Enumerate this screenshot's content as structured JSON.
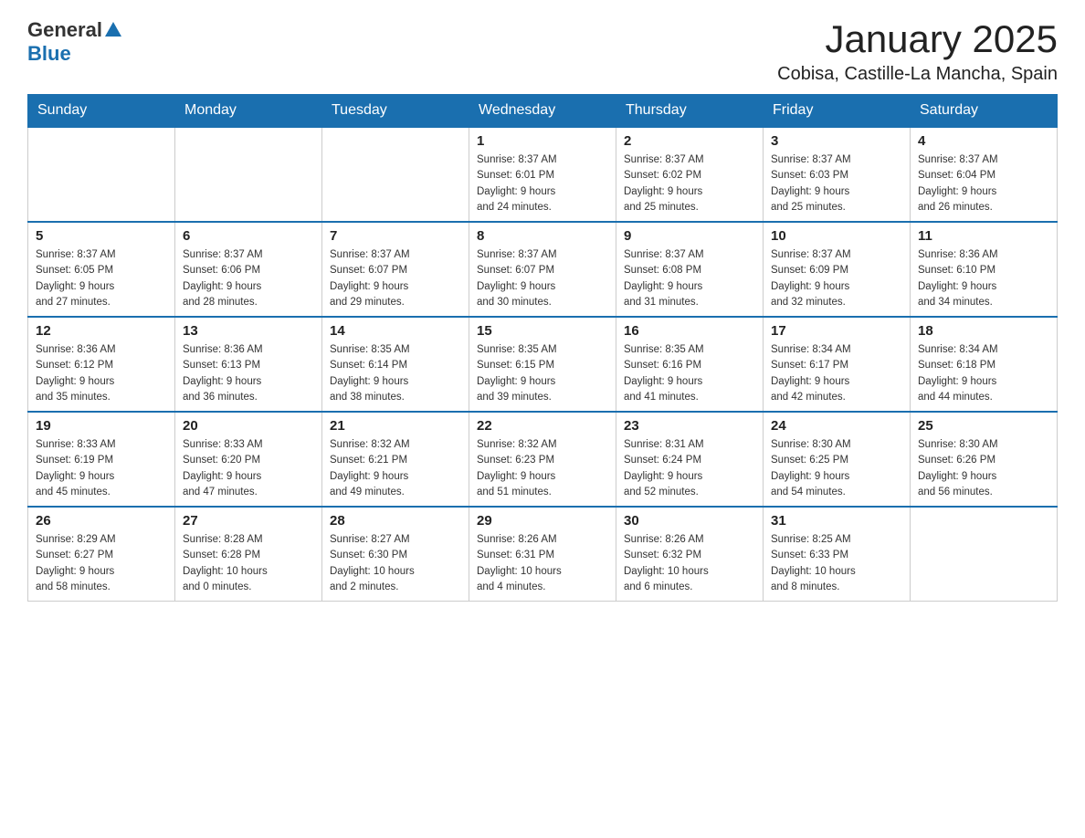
{
  "header": {
    "logo_general": "General",
    "logo_blue": "Blue",
    "month_title": "January 2025",
    "location": "Cobisa, Castille-La Mancha, Spain"
  },
  "weekdays": [
    "Sunday",
    "Monday",
    "Tuesday",
    "Wednesday",
    "Thursday",
    "Friday",
    "Saturday"
  ],
  "weeks": [
    [
      {
        "day": "",
        "info": ""
      },
      {
        "day": "",
        "info": ""
      },
      {
        "day": "",
        "info": ""
      },
      {
        "day": "1",
        "info": "Sunrise: 8:37 AM\nSunset: 6:01 PM\nDaylight: 9 hours\nand 24 minutes."
      },
      {
        "day": "2",
        "info": "Sunrise: 8:37 AM\nSunset: 6:02 PM\nDaylight: 9 hours\nand 25 minutes."
      },
      {
        "day": "3",
        "info": "Sunrise: 8:37 AM\nSunset: 6:03 PM\nDaylight: 9 hours\nand 25 minutes."
      },
      {
        "day": "4",
        "info": "Sunrise: 8:37 AM\nSunset: 6:04 PM\nDaylight: 9 hours\nand 26 minutes."
      }
    ],
    [
      {
        "day": "5",
        "info": "Sunrise: 8:37 AM\nSunset: 6:05 PM\nDaylight: 9 hours\nand 27 minutes."
      },
      {
        "day": "6",
        "info": "Sunrise: 8:37 AM\nSunset: 6:06 PM\nDaylight: 9 hours\nand 28 minutes."
      },
      {
        "day": "7",
        "info": "Sunrise: 8:37 AM\nSunset: 6:07 PM\nDaylight: 9 hours\nand 29 minutes."
      },
      {
        "day": "8",
        "info": "Sunrise: 8:37 AM\nSunset: 6:07 PM\nDaylight: 9 hours\nand 30 minutes."
      },
      {
        "day": "9",
        "info": "Sunrise: 8:37 AM\nSunset: 6:08 PM\nDaylight: 9 hours\nand 31 minutes."
      },
      {
        "day": "10",
        "info": "Sunrise: 8:37 AM\nSunset: 6:09 PM\nDaylight: 9 hours\nand 32 minutes."
      },
      {
        "day": "11",
        "info": "Sunrise: 8:36 AM\nSunset: 6:10 PM\nDaylight: 9 hours\nand 34 minutes."
      }
    ],
    [
      {
        "day": "12",
        "info": "Sunrise: 8:36 AM\nSunset: 6:12 PM\nDaylight: 9 hours\nand 35 minutes."
      },
      {
        "day": "13",
        "info": "Sunrise: 8:36 AM\nSunset: 6:13 PM\nDaylight: 9 hours\nand 36 minutes."
      },
      {
        "day": "14",
        "info": "Sunrise: 8:35 AM\nSunset: 6:14 PM\nDaylight: 9 hours\nand 38 minutes."
      },
      {
        "day": "15",
        "info": "Sunrise: 8:35 AM\nSunset: 6:15 PM\nDaylight: 9 hours\nand 39 minutes."
      },
      {
        "day": "16",
        "info": "Sunrise: 8:35 AM\nSunset: 6:16 PM\nDaylight: 9 hours\nand 41 minutes."
      },
      {
        "day": "17",
        "info": "Sunrise: 8:34 AM\nSunset: 6:17 PM\nDaylight: 9 hours\nand 42 minutes."
      },
      {
        "day": "18",
        "info": "Sunrise: 8:34 AM\nSunset: 6:18 PM\nDaylight: 9 hours\nand 44 minutes."
      }
    ],
    [
      {
        "day": "19",
        "info": "Sunrise: 8:33 AM\nSunset: 6:19 PM\nDaylight: 9 hours\nand 45 minutes."
      },
      {
        "day": "20",
        "info": "Sunrise: 8:33 AM\nSunset: 6:20 PM\nDaylight: 9 hours\nand 47 minutes."
      },
      {
        "day": "21",
        "info": "Sunrise: 8:32 AM\nSunset: 6:21 PM\nDaylight: 9 hours\nand 49 minutes."
      },
      {
        "day": "22",
        "info": "Sunrise: 8:32 AM\nSunset: 6:23 PM\nDaylight: 9 hours\nand 51 minutes."
      },
      {
        "day": "23",
        "info": "Sunrise: 8:31 AM\nSunset: 6:24 PM\nDaylight: 9 hours\nand 52 minutes."
      },
      {
        "day": "24",
        "info": "Sunrise: 8:30 AM\nSunset: 6:25 PM\nDaylight: 9 hours\nand 54 minutes."
      },
      {
        "day": "25",
        "info": "Sunrise: 8:30 AM\nSunset: 6:26 PM\nDaylight: 9 hours\nand 56 minutes."
      }
    ],
    [
      {
        "day": "26",
        "info": "Sunrise: 8:29 AM\nSunset: 6:27 PM\nDaylight: 9 hours\nand 58 minutes."
      },
      {
        "day": "27",
        "info": "Sunrise: 8:28 AM\nSunset: 6:28 PM\nDaylight: 10 hours\nand 0 minutes."
      },
      {
        "day": "28",
        "info": "Sunrise: 8:27 AM\nSunset: 6:30 PM\nDaylight: 10 hours\nand 2 minutes."
      },
      {
        "day": "29",
        "info": "Sunrise: 8:26 AM\nSunset: 6:31 PM\nDaylight: 10 hours\nand 4 minutes."
      },
      {
        "day": "30",
        "info": "Sunrise: 8:26 AM\nSunset: 6:32 PM\nDaylight: 10 hours\nand 6 minutes."
      },
      {
        "day": "31",
        "info": "Sunrise: 8:25 AM\nSunset: 6:33 PM\nDaylight: 10 hours\nand 8 minutes."
      },
      {
        "day": "",
        "info": ""
      }
    ]
  ]
}
